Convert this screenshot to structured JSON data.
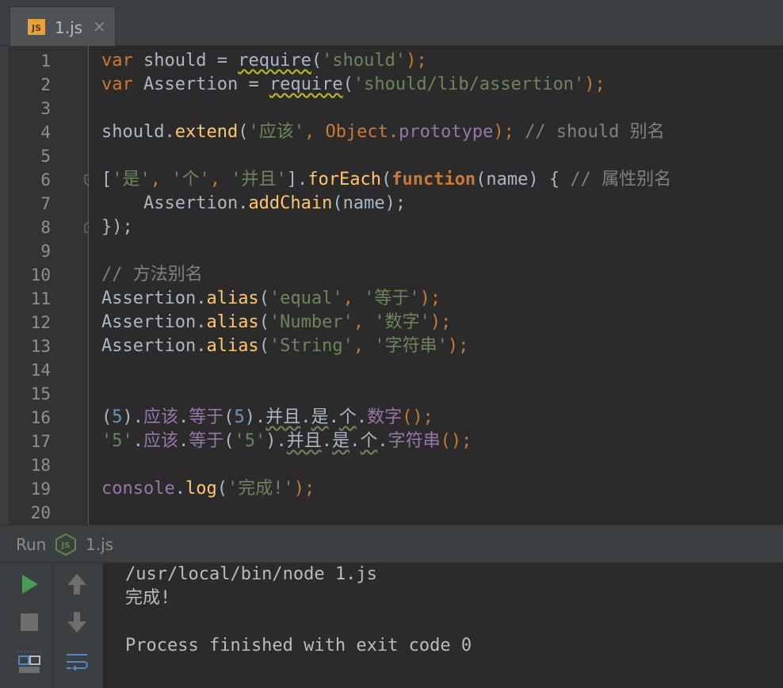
{
  "tab": {
    "label": "1.js",
    "close": "×",
    "icon_text": "JS"
  },
  "line_numbers": [
    "1",
    "2",
    "3",
    "4",
    "5",
    "6",
    "7",
    "8",
    "9",
    "10",
    "11",
    "12",
    "13",
    "14",
    "15",
    "16",
    "17",
    "18",
    "19",
    "20"
  ],
  "code": {
    "l1": {
      "kw": "var",
      "a": " should = ",
      "req": "require",
      "b": "(",
      "s": "'should'",
      "c": ");"
    },
    "l2": {
      "kw": "var",
      "a": " Assertion = ",
      "req": "require",
      "b": "(",
      "s": "'should/lib/assertion'",
      "c": ");"
    },
    "l4": {
      "a": "should.",
      "fn": "extend",
      "b": "(",
      "s": "'应该'",
      "c": ", Object.",
      "prop": "prototype",
      "d": ");",
      "cmt": " // should 别名"
    },
    "l6": {
      "a": "[",
      "s1": "'是'",
      "c1": ", ",
      "s2": "'个'",
      "c2": ", ",
      "s3": "'并且'",
      "b": "].",
      "fn": "forEach",
      "p": "(",
      "kw": "function",
      "c": "(name) { ",
      "cmt": "// 属性别名"
    },
    "l7": {
      "a": "    Assertion.",
      "fn": "addChain",
      "b": "(name);"
    },
    "l8": {
      "a": "});"
    },
    "l10": {
      "cmt": "// 方法别名"
    },
    "l11": {
      "a": "Assertion.",
      "fn": "alias",
      "b": "(",
      "s1": "'equal'",
      "c": ", ",
      "s2": "'等于'",
      "d": ");"
    },
    "l12": {
      "a": "Assertion.",
      "fn": "alias",
      "b": "(",
      "s1": "'Number'",
      "c": ", ",
      "s2": "'数字'",
      "d": ");"
    },
    "l13": {
      "a": "Assertion.",
      "fn": "alias",
      "b": "(",
      "s1": "'String'",
      "c": ", ",
      "s2": "'字符串'",
      "d": ");"
    },
    "l16": {
      "a": "(",
      "num": "5",
      "b": ").",
      "p1": "应该",
      "c": ".",
      "p2": "等于",
      "d": "(",
      "num2": "5",
      "e": ").",
      "p3": "并且",
      "f": ".",
      "p4": "是",
      "g": ".",
      "p5": "个",
      "h": ".",
      "p6": "数字",
      "i": "();"
    },
    "l17": {
      "s": "'5'",
      "b": ".",
      "p1": "应该",
      "c": ".",
      "p2": "等于",
      "d": "(",
      "s2": "'5'",
      "e": ").",
      "p3": "并且",
      "f": ".",
      "p4": "是",
      "g": ".",
      "p5": "个",
      "h": ".",
      "p6": "字符串",
      "i": "();"
    },
    "l19": {
      "prop": "console",
      "a": ".",
      "fn": "log",
      "b": "(",
      "s": "'完成!'",
      "c": ");"
    }
  },
  "run": {
    "label": "Run",
    "file": "1.js",
    "node_icon_text": "JS"
  },
  "console_output": [
    "/usr/local/bin/node 1.js",
    "完成!",
    "",
    "Process finished with exit code 0"
  ],
  "colors": {
    "keyword": "#cc7832",
    "string": "#6a8759",
    "function": "#ffc66d",
    "property": "#9876aa",
    "number": "#6897bb",
    "comment": "#808080",
    "run_green": "#499c54"
  }
}
